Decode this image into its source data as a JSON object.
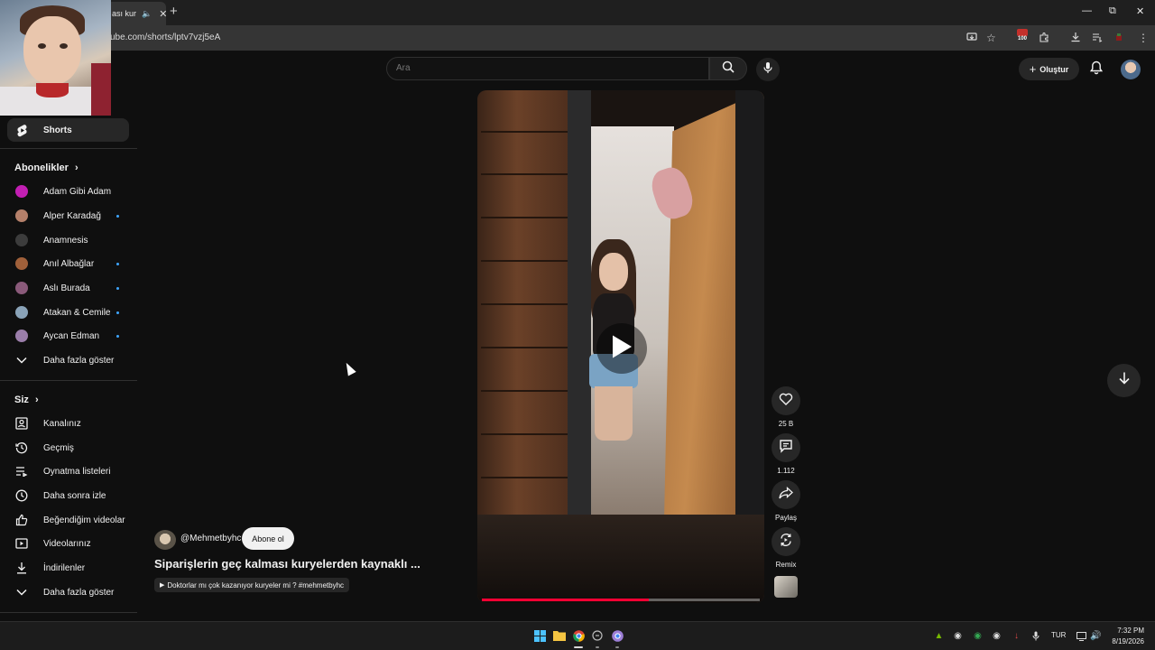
{
  "browser": {
    "tab_title": "ası kur",
    "url": "ube.com/shorts/lptv7vzj5eA",
    "toolbar_badge": "100"
  },
  "search": {
    "placeholder": "Ara"
  },
  "masthead": {
    "create_label": "Oluştur"
  },
  "sidebar": {
    "shorts_label": "Shorts",
    "subscriptions_title": "Abonelikler",
    "subscriptions": [
      {
        "name": "Adam Gibi Adam",
        "color": "#c21fb3",
        "new": false
      },
      {
        "name": "Alper Karadağ",
        "color": "#b5806a",
        "new": true
      },
      {
        "name": "Anamnesis",
        "color": "#3c3c3c",
        "new": false
      },
      {
        "name": "Anıl Albağlar",
        "color": "#a0603a",
        "new": true
      },
      {
        "name": "Aslı Burada",
        "color": "#8a5a7a",
        "new": true
      },
      {
        "name": "Atakan & Cemile",
        "color": "#8aa3b8",
        "new": true
      },
      {
        "name": "Aycan Edman",
        "color": "#9b7eaa",
        "new": true
      }
    ],
    "subscriptions_more": "Daha fazla göster",
    "you_title": "Siz",
    "you_items": [
      {
        "label": "Kanalınız",
        "icon": "channel-icon"
      },
      {
        "label": "Geçmiş",
        "icon": "history-icon"
      },
      {
        "label": "Oynatma listeleri",
        "icon": "playlists-icon"
      },
      {
        "label": "Daha sonra izle",
        "icon": "watch-later-icon"
      },
      {
        "label": "Beğendiğim videolar",
        "icon": "liked-icon"
      },
      {
        "label": "Videolarınız",
        "icon": "your-videos-icon"
      },
      {
        "label": "İndirilenler",
        "icon": "downloads-icon"
      }
    ],
    "you_more": "Daha fazla göster"
  },
  "video": {
    "progress": 0.6,
    "channel_handle": "@Mehmetbyhc",
    "subscribe_label": "Abone ol",
    "title": "Siparişlerin geç kalması kuryelerden kaynaklı ...",
    "related_chip": "Doktorlar mı çok kazanıyor kuryeler mi ? #mehmetbyhc"
  },
  "actions": {
    "like_count": "25 B",
    "comment_count": "1.112",
    "share_label": "Paylaş",
    "remix_label": "Remix"
  },
  "taskbar": {
    "language": "TUR",
    "time": "7:32 PM",
    "date": "8/19/2026"
  },
  "colors": {
    "background": "#0f0f0f",
    "accent_red": "#ff0033",
    "chip": "#272727"
  }
}
